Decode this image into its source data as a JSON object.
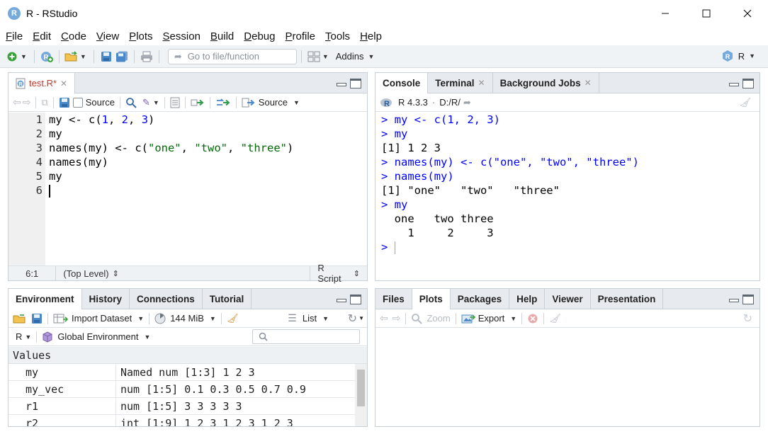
{
  "window": {
    "title": "R - RStudio",
    "logo": "R"
  },
  "menu": [
    {
      "pre": "",
      "mn": "F",
      "post": "ile"
    },
    {
      "pre": "",
      "mn": "E",
      "post": "dit"
    },
    {
      "pre": "",
      "mn": "C",
      "post": "ode"
    },
    {
      "pre": "",
      "mn": "V",
      "post": "iew"
    },
    {
      "pre": "",
      "mn": "P",
      "post": "lots"
    },
    {
      "pre": "",
      "mn": "S",
      "post": "ession"
    },
    {
      "pre": "",
      "mn": "B",
      "post": "uild"
    },
    {
      "pre": "",
      "mn": "D",
      "post": "ebug"
    },
    {
      "pre": "",
      "mn": "P",
      "post": "rofile"
    },
    {
      "pre": "",
      "mn": "T",
      "post": "ools"
    },
    {
      "pre": "",
      "mn": "H",
      "post": "elp"
    }
  ],
  "toolbar": {
    "goto_placeholder": "Go to file/function",
    "addins": "Addins",
    "project": "R"
  },
  "source": {
    "tab": "test.R*",
    "source_on_save": "Source",
    "source_button": "Source",
    "line_numbers": [
      "1",
      "2",
      "3",
      "4",
      "5",
      "6"
    ],
    "lines": [
      [
        {
          "t": "my <- c(",
          "c": ""
        },
        {
          "t": "1",
          "c": "num"
        },
        {
          "t": ", ",
          "c": ""
        },
        {
          "t": "2",
          "c": "num"
        },
        {
          "t": ", ",
          "c": ""
        },
        {
          "t": "3",
          "c": "num"
        },
        {
          "t": ")",
          "c": ""
        }
      ],
      [
        {
          "t": "my",
          "c": ""
        }
      ],
      [
        {
          "t": "names(my) <- c(",
          "c": ""
        },
        {
          "t": "\"one\"",
          "c": "str"
        },
        {
          "t": ", ",
          "c": ""
        },
        {
          "t": "\"two\"",
          "c": "str"
        },
        {
          "t": ", ",
          "c": ""
        },
        {
          "t": "\"three\"",
          "c": "str"
        },
        {
          "t": ")",
          "c": ""
        }
      ],
      [
        {
          "t": "names(my)",
          "c": ""
        }
      ],
      [
        {
          "t": "my",
          "c": ""
        }
      ],
      [
        {
          "t": "",
          "c": ""
        }
      ]
    ],
    "status": {
      "position": "6:1",
      "scope": "(Top Level)",
      "filetype": "R Script"
    }
  },
  "console_pane": {
    "tabs": [
      "Console",
      "Terminal",
      "Background Jobs"
    ],
    "version": "R 4.3.3",
    "path": "D:/R/",
    "lines": [
      {
        "t": "> my <- c(1, 2, 3)",
        "c": "cin"
      },
      {
        "t": "> my",
        "c": "cin"
      },
      {
        "t": "[1] 1 2 3",
        "c": "cout"
      },
      {
        "t": "> names(my) <- c(\"one\", \"two\", \"three\")",
        "c": "cin"
      },
      {
        "t": "> names(my)",
        "c": "cin"
      },
      {
        "t": "[1] \"one\"   \"two\"   \"three\"",
        "c": "cout"
      },
      {
        "t": "> my",
        "c": "cin"
      },
      {
        "t": "  one   two three ",
        "c": "cout"
      },
      {
        "t": "    1     2     3 ",
        "c": "cout"
      }
    ],
    "prompt": "> "
  },
  "env_pane": {
    "tabs": [
      "Environment",
      "History",
      "Connections",
      "Tutorial"
    ],
    "import_dataset": "Import Dataset",
    "memory": "144 MiB",
    "view_mode": "List",
    "language": "R",
    "scope": "Global Environment",
    "section": "Values",
    "rows": [
      {
        "name": "my",
        "value": "Named num [1:3] 1 2 3"
      },
      {
        "name": "my_vec",
        "value": "num [1:5] 0.1 0.3 0.5 0.7 0.9"
      },
      {
        "name": "r1",
        "value": "num [1:5] 3 3 3 3 3"
      },
      {
        "name": "r2",
        "value": "int [1:9] 1 2 3 1 2 3 1 2 3"
      }
    ]
  },
  "files_pane": {
    "tabs": [
      "Files",
      "Plots",
      "Packages",
      "Help",
      "Viewer",
      "Presentation"
    ],
    "zoom": "Zoom",
    "export": "Export"
  }
}
